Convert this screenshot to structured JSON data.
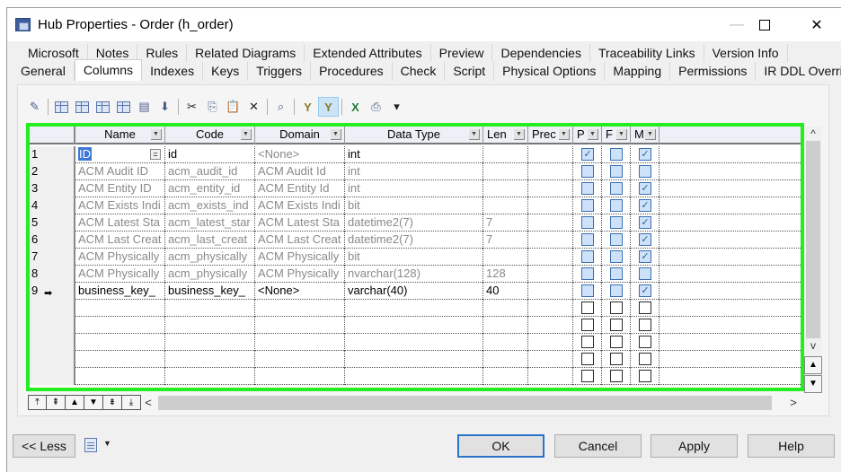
{
  "window": {
    "title": "Hub Properties - Order (h_order)",
    "controls": {
      "minimize": "—",
      "maximize": "",
      "close": "✕"
    }
  },
  "tabs": {
    "row1": [
      "Microsoft",
      "Notes",
      "Rules",
      "Related Diagrams",
      "Extended Attributes",
      "Preview",
      "Dependencies",
      "Traceability Links",
      "Version Info"
    ],
    "row2": [
      "General",
      "Columns",
      "Indexes",
      "Keys",
      "Triggers",
      "Procedures",
      "Check",
      "Script",
      "Physical Options",
      "Mapping",
      "Permissions",
      "IR DDL Override"
    ],
    "active": "Columns"
  },
  "toolbar": {
    "icons": [
      "properties-icon",
      "add-row-icon",
      "insert-row-icon",
      "add-columns-icon",
      "reuse-columns-icon",
      "replicate-icon",
      "shortcut-icon",
      "cut-icon",
      "copy-icon",
      "paste-icon",
      "delete-icon",
      "find-icon",
      "filter-icon",
      "filter-enabled-icon",
      "excel-export-icon",
      "print-icon",
      "more-dropdown-icon"
    ],
    "glyphs": [
      "✎",
      "",
      "",
      "",
      "",
      "▤",
      "⬇",
      "✂",
      "⎘",
      "📋",
      "✕",
      "⌕",
      "Y",
      "Y",
      "X",
      "⎙",
      "▾"
    ]
  },
  "grid": {
    "columns": [
      "Name",
      "Code",
      "Domain",
      "Data Type",
      "Len",
      "Prec",
      "P",
      "F",
      "M"
    ],
    "rows": [
      {
        "num": "1",
        "name": "ID",
        "code": "id",
        "domain": "<None>",
        "data_type": "int",
        "len": "",
        "prec": "",
        "p": true,
        "f": false,
        "m": true,
        "inherited": false,
        "selected": true
      },
      {
        "num": "2",
        "name": "ACM Audit ID",
        "code": "acm_audit_id",
        "domain": "ACM Audit Id",
        "data_type": "int",
        "len": "",
        "prec": "",
        "p": false,
        "f": false,
        "m": false,
        "inherited": true
      },
      {
        "num": "3",
        "name": "ACM Entity ID",
        "code": "acm_entity_id",
        "domain": "ACM Entity Id",
        "data_type": "int",
        "len": "",
        "prec": "",
        "p": false,
        "f": false,
        "m": true,
        "inherited": true
      },
      {
        "num": "4",
        "name": "ACM Exists Indi",
        "code": "acm_exists_ind",
        "domain": "ACM Exists Indi",
        "data_type": "bit",
        "len": "",
        "prec": "",
        "p": false,
        "f": false,
        "m": true,
        "inherited": true
      },
      {
        "num": "5",
        "name": "ACM Latest Sta",
        "code": "acm_latest_star",
        "domain": "ACM Latest Sta",
        "data_type": "datetime2(7)",
        "len": "7",
        "prec": "",
        "p": false,
        "f": false,
        "m": true,
        "inherited": true
      },
      {
        "num": "6",
        "name": "ACM Last Creat",
        "code": "acm_last_creat",
        "domain": "ACM Last Creat",
        "data_type": "datetime2(7)",
        "len": "7",
        "prec": "",
        "p": false,
        "f": false,
        "m": true,
        "inherited": true
      },
      {
        "num": "7",
        "name": "ACM Physically",
        "code": "acm_physically",
        "domain": "ACM Physically",
        "data_type": "bit",
        "len": "",
        "prec": "",
        "p": false,
        "f": false,
        "m": true,
        "inherited": true
      },
      {
        "num": "8",
        "name": "ACM Physically",
        "code": "acm_physically",
        "domain": "ACM Physically",
        "data_type": "nvarchar(128)",
        "len": "128",
        "prec": "",
        "p": false,
        "f": false,
        "m": false,
        "inherited": true
      },
      {
        "num": "9",
        "name": "business_key_",
        "code": "business_key_",
        "domain": "<None>",
        "data_type": "varchar(40)",
        "len": "40",
        "prec": "",
        "p": false,
        "f": false,
        "m": true,
        "inherited": false,
        "current": true
      }
    ],
    "empty_rows": 5,
    "current_row_indicator": "➡",
    "ellipsis_button": "="
  },
  "nav_buttons": [
    "⤒",
    "⇞",
    "▲",
    "▼",
    "⇟",
    "⤓"
  ],
  "nav_names": [
    "move-to-top",
    "move-page-up",
    "move-up",
    "move-down",
    "move-page-down",
    "move-to-bottom"
  ],
  "scroll": {
    "left": "<",
    "right": ">",
    "up": "^",
    "down": "v",
    "top": "▲",
    "bottom": "▼"
  },
  "footer": {
    "less": "<< Less",
    "ok": "OK",
    "cancel": "Cancel",
    "apply": "Apply",
    "help": "Help",
    "menu_dropdown": "▼"
  }
}
